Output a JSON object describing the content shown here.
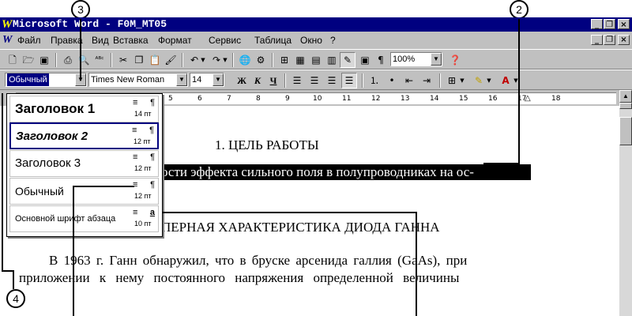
{
  "window": {
    "app_icon": "word-icon",
    "title": "Microsoft Word - F0M_MT05",
    "caption_buttons": [
      "_",
      "❐",
      "×"
    ]
  },
  "menubar": {
    "doc_icon": "document-icon",
    "items": [
      "Файл",
      "Правка",
      "Вид",
      "Вставка",
      "Формат",
      "Сервис",
      "Таблица",
      "Окно",
      "?"
    ],
    "doc_buttons": [
      "_",
      "❐",
      "×"
    ]
  },
  "standard_toolbar": {
    "zoom": "100%"
  },
  "format_toolbar": {
    "style": "Обычный",
    "font": "Times New Roman",
    "size": "14",
    "bold": "Ж",
    "italic": "К",
    "underline": "Ч"
  },
  "ruler": {
    "ticks": [
      "5",
      "6",
      "7",
      "8",
      "9",
      "10",
      "11",
      "12",
      "13",
      "14",
      "15",
      "16",
      "17",
      "18"
    ]
  },
  "style_dropdown": {
    "items": [
      {
        "label": "Заголовок 1",
        "align": "≡",
        "mark": "¶",
        "size": "14 пт"
      },
      {
        "label": "Заголовок 2",
        "align": "≡",
        "mark": "¶",
        "size": "12 пт"
      },
      {
        "label": "Заголовок 3",
        "align": "≡",
        "mark": "¶",
        "size": "12 пт"
      },
      {
        "label": "Обычный",
        "align": "≡",
        "mark": "¶",
        "size": "12 пт"
      },
      {
        "label": "Основной шрифт абзаца",
        "align": "≡",
        "mark": "a",
        "size": "10 пт"
      }
    ]
  },
  "document": {
    "heading1": "1. ЦЕЛЬ РАБОТЫ",
    "selected_line": "ости эффекта сильного поля в полупроводниках на ос-",
    "heading2": "ПЕРНАЯ ХАРАКТЕРИСТИКА ДИОДА ГАННА",
    "para_line1": "В 1963 г. Ганн обнаружил, что в бруске арсенида галлия (GaAs), при",
    "para_line2": "приложении к нему постоянного напряжения определенной величины"
  },
  "callouts": {
    "c2": "2",
    "c3": "3",
    "c4": "4"
  }
}
